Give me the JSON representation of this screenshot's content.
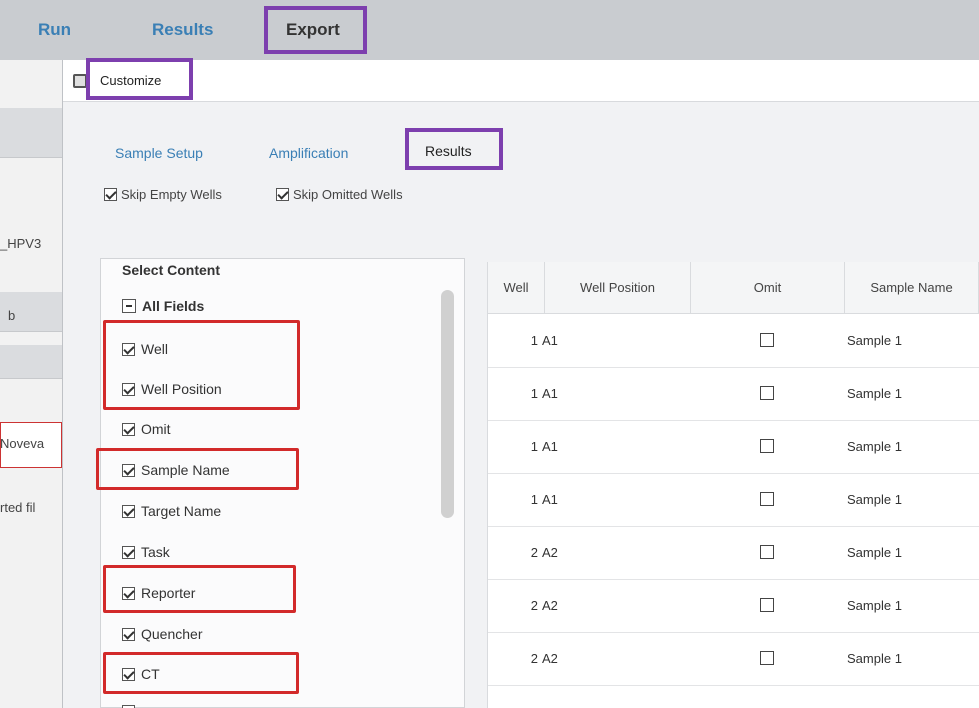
{
  "topnav": {
    "run": "Run",
    "results": "Results",
    "export": "Export"
  },
  "background": {
    "row1": "_HPV3",
    "row2": "b",
    "row3": "Noveva",
    "row4": "rted fil"
  },
  "dialog": {
    "title": "Customize"
  },
  "tabs": [
    {
      "label": "Sample Setup",
      "active": false
    },
    {
      "label": "Amplification",
      "active": false
    },
    {
      "label": "Results",
      "active": true
    }
  ],
  "options": {
    "skip_empty": "Skip Empty Wells",
    "skip_omitted": "Skip Omitted Wells"
  },
  "select_content": {
    "title": "Select Content",
    "all_fields": "All Fields",
    "fields": [
      "Well",
      "Well Position",
      "Omit",
      "Sample Name",
      "Target Name",
      "Task",
      "Reporter",
      "Quencher",
      "CT"
    ]
  },
  "table": {
    "headers": [
      "Well",
      "Well Position",
      "Omit",
      "Sample Name"
    ],
    "rows": [
      {
        "well": "1",
        "position": "A1",
        "sample": "Sample 1"
      },
      {
        "well": "1",
        "position": "A1",
        "sample": "Sample 1"
      },
      {
        "well": "1",
        "position": "A1",
        "sample": "Sample 1"
      },
      {
        "well": "1",
        "position": "A1",
        "sample": "Sample 1"
      },
      {
        "well": "2",
        "position": "A2",
        "sample": "Sample 1"
      },
      {
        "well": "2",
        "position": "A2",
        "sample": "Sample 1"
      },
      {
        "well": "2",
        "position": "A2",
        "sample": "Sample 1"
      }
    ]
  },
  "colors": {
    "highlight_purple": "#7d3fae",
    "highlight_red": "#d22a2a",
    "link_blue": "#3a7fb5"
  }
}
